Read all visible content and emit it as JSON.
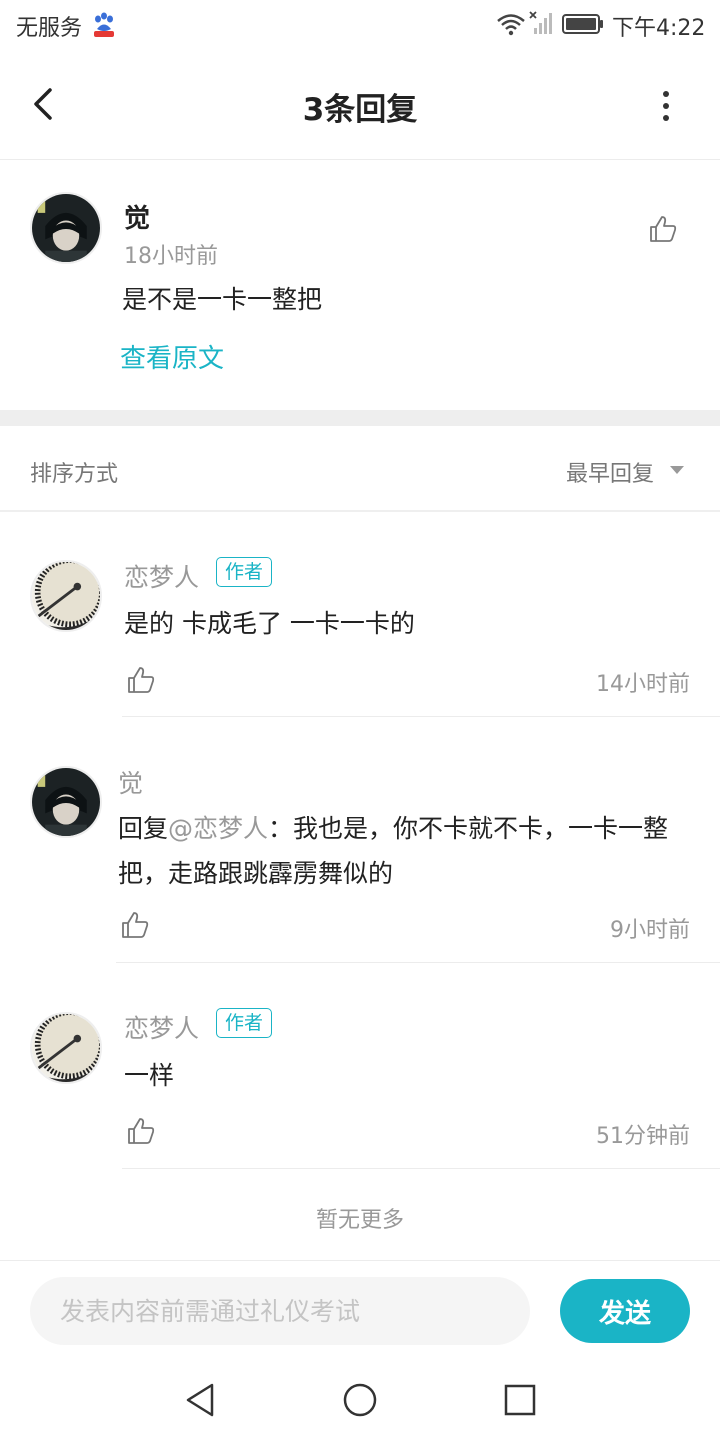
{
  "status_bar": {
    "carrier": "无服务",
    "time": "下午4:22"
  },
  "header": {
    "title": "3条回复"
  },
  "main_comment": {
    "author": "觉",
    "time": "18小时前",
    "text": "是不是一卡一整把",
    "view_original": "查看原文"
  },
  "sort": {
    "label": "排序方式",
    "value": "最早回复"
  },
  "replies": [
    {
      "author": "恋梦人",
      "badge": "作者",
      "text": "是的  卡成毛了  一卡一卡的",
      "time": "14小时前"
    },
    {
      "author": "觉",
      "reply_prefix": "回复",
      "mention": "@恋梦人",
      "text": "：我也是，你不卡就不卡，一卡一整把，走路跟跳霹雳舞似的",
      "time": "9小时前"
    },
    {
      "author": "恋梦人",
      "badge": "作者",
      "text": "一样",
      "time": "51分钟前"
    }
  ],
  "footer_note": "暂无更多",
  "input": {
    "placeholder": "发表内容前需通过礼仪考试",
    "send_label": "发送"
  },
  "colors": {
    "accent": "#1ab4c6",
    "muted_text": "#999999",
    "divider": "#eeeeee"
  }
}
